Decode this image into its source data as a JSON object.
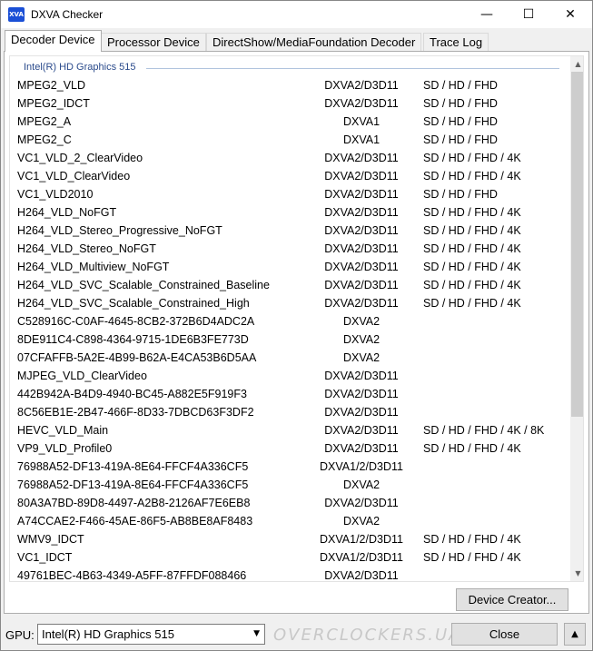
{
  "window": {
    "title": "DXVA Checker",
    "icon_label": "XVA",
    "minimize_glyph": "—",
    "maximize_glyph": "☐",
    "close_glyph": "✕"
  },
  "tabs": [
    {
      "label": "Decoder Device",
      "active": true
    },
    {
      "label": "Processor Device",
      "active": false
    },
    {
      "label": "DirectShow/MediaFoundation Decoder",
      "active": false
    },
    {
      "label": "Trace Log",
      "active": false
    }
  ],
  "decoder_list": {
    "group_title": "Intel(R) HD Graphics 515",
    "rows": [
      {
        "name": "MPEG2_VLD",
        "api": "DXVA2/D3D11",
        "res": "SD / HD / FHD"
      },
      {
        "name": "MPEG2_IDCT",
        "api": "DXVA2/D3D11",
        "res": "SD / HD / FHD"
      },
      {
        "name": "MPEG2_A",
        "api": "DXVA1",
        "res": "SD / HD / FHD"
      },
      {
        "name": "MPEG2_C",
        "api": "DXVA1",
        "res": "SD / HD / FHD"
      },
      {
        "name": "VC1_VLD_2_ClearVideo",
        "api": "DXVA2/D3D11",
        "res": "SD / HD / FHD / 4K"
      },
      {
        "name": "VC1_VLD_ClearVideo",
        "api": "DXVA2/D3D11",
        "res": "SD / HD / FHD / 4K"
      },
      {
        "name": "VC1_VLD2010",
        "api": "DXVA2/D3D11",
        "res": "SD / HD / FHD"
      },
      {
        "name": "H264_VLD_NoFGT",
        "api": "DXVA2/D3D11",
        "res": "SD / HD / FHD / 4K"
      },
      {
        "name": "H264_VLD_Stereo_Progressive_NoFGT",
        "api": "DXVA2/D3D11",
        "res": "SD / HD / FHD / 4K"
      },
      {
        "name": "H264_VLD_Stereo_NoFGT",
        "api": "DXVA2/D3D11",
        "res": "SD / HD / FHD / 4K"
      },
      {
        "name": "H264_VLD_Multiview_NoFGT",
        "api": "DXVA2/D3D11",
        "res": "SD / HD / FHD / 4K"
      },
      {
        "name": "H264_VLD_SVC_Scalable_Constrained_Baseline",
        "api": "DXVA2/D3D11",
        "res": "SD / HD / FHD / 4K"
      },
      {
        "name": "H264_VLD_SVC_Scalable_Constrained_High",
        "api": "DXVA2/D3D11",
        "res": "SD / HD / FHD / 4K"
      },
      {
        "name": "C528916C-C0AF-4645-8CB2-372B6D4ADC2A",
        "api": "DXVA2",
        "res": ""
      },
      {
        "name": "8DE911C4-C898-4364-9715-1DE6B3FE773D",
        "api": "DXVA2",
        "res": ""
      },
      {
        "name": "07CFAFFB-5A2E-4B99-B62A-E4CA53B6D5AA",
        "api": "DXVA2",
        "res": ""
      },
      {
        "name": "MJPEG_VLD_ClearVideo",
        "api": "DXVA2/D3D11",
        "res": ""
      },
      {
        "name": "442B942A-B4D9-4940-BC45-A882E5F919F3",
        "api": "DXVA2/D3D11",
        "res": ""
      },
      {
        "name": "8C56EB1E-2B47-466F-8D33-7DBCD63F3DF2",
        "api": "DXVA2/D3D11",
        "res": ""
      },
      {
        "name": "HEVC_VLD_Main",
        "api": "DXVA2/D3D11",
        "res": "SD / HD / FHD / 4K / 8K"
      },
      {
        "name": "VP9_VLD_Profile0",
        "api": "DXVA2/D3D11",
        "res": "SD / HD / FHD / 4K"
      },
      {
        "name": "76988A52-DF13-419A-8E64-FFCF4A336CF5",
        "api": "DXVA1/2/D3D11",
        "res": ""
      },
      {
        "name": "76988A52-DF13-419A-8E64-FFCF4A336CF5",
        "api": "DXVA2",
        "res": ""
      },
      {
        "name": "80A3A7BD-89D8-4497-A2B8-2126AF7E6EB8",
        "api": "DXVA2/D3D11",
        "res": ""
      },
      {
        "name": "A74CCAE2-F466-45AE-86F5-AB8BE8AF8483",
        "api": "DXVA2",
        "res": ""
      },
      {
        "name": "WMV9_IDCT",
        "api": "DXVA1/2/D3D11",
        "res": "SD / HD / FHD / 4K"
      },
      {
        "name": "VC1_IDCT",
        "api": "DXVA1/2/D3D11",
        "res": "SD / HD / FHD / 4K"
      },
      {
        "name": "49761BEC-4B63-4349-A5FF-87FFDF088466",
        "api": "DXVA2/D3D11",
        "res": ""
      }
    ],
    "scroll_up_glyph": "▲",
    "scroll_down_glyph": "▼"
  },
  "device_creator_label": "Device Creator...",
  "footer": {
    "gpu_label": "GPU:",
    "gpu_value": "Intel(R) HD Graphics 515",
    "gpu_dropdown_glyph": "▼",
    "close_label": "Close",
    "collapse_glyph": "▲",
    "watermark": "OVERCLOCKERS.UA"
  }
}
